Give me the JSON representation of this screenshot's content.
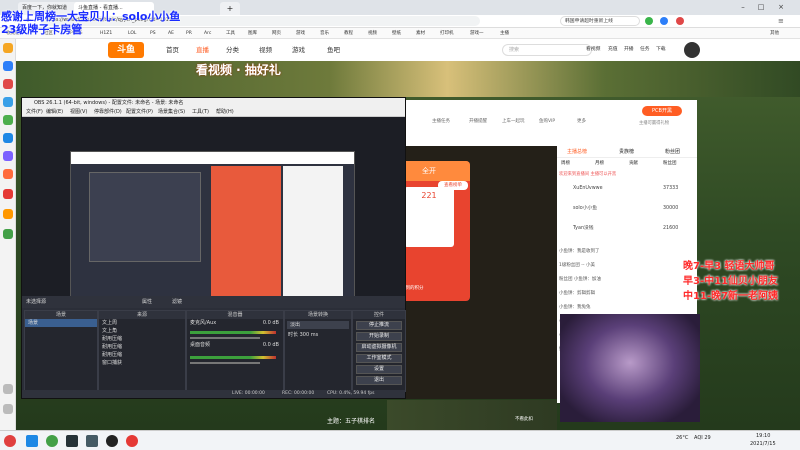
{
  "browser": {
    "tabs": [
      "百度一下，你就知道",
      "斗鱼直播 - 看直播...",
      "",
      ""
    ],
    "url": "https://www.douyu.com/topic/qyyzh_pubg?rid=101367",
    "search_text": "韩国申请超时重新上线",
    "bookmarks": [
      "收藏栏",
      "社区",
      "PUBG",
      "H1Z1",
      "LOL",
      "PS",
      "AE",
      "PR",
      "Arc",
      "工具",
      "图库",
      "网页",
      "游戏",
      "音乐",
      "教程",
      "视频",
      "壁纸",
      "素材",
      "打印机",
      "游戏一",
      "主播",
      "其他"
    ]
  },
  "site": {
    "logo": "斗鱼",
    "nav": [
      "首页",
      "直播",
      "分类",
      "视频",
      "游戏",
      "鱼吧"
    ],
    "search_placeholder": "搜索",
    "right_links": [
      "看视频",
      "充值",
      "开播",
      "任务",
      "下载"
    ],
    "banner_text": "看视频 · 抽好礼"
  },
  "obs": {
    "title": "OBS 26.1.1 (64-bit, windows) - 配置文件: 未命名 - 场景: 未命名",
    "menu": [
      "文件(F)",
      "编辑(E)",
      "视图(V)",
      "停靠部件(D)",
      "配置文件(P)",
      "场景集合(S)",
      "工具(T)",
      "帮助(H)"
    ],
    "no_source": "未选择源",
    "tabs": [
      "属性",
      "滤镜"
    ],
    "panels": {
      "scenes": {
        "title": "场景",
        "items": [
          "场景"
        ]
      },
      "sources": {
        "title": "来源",
        "items": [
          "文上周",
          "文上角",
          "耐用压缩",
          "耐用压缩",
          "耐用压缩",
          "窗口捕获"
        ]
      },
      "mixer": {
        "title": "混音器",
        "items": [
          "麦克风/Aux",
          "桌面音频"
        ],
        "db": [
          "0.0 dB",
          "0.0 dB"
        ]
      },
      "transitions": {
        "title": "场景转换",
        "type": "淡出",
        "duration_label": "时长",
        "duration": "300 ms"
      },
      "controls": {
        "title": "控件",
        "buttons": [
          "停止推流",
          "开始录制",
          "启动虚拟摄像机",
          "工作室模式",
          "设置",
          "退出"
        ]
      }
    },
    "status": [
      "LIVE: 00:00:00",
      "REC: 00:00:00",
      "CPU: 0.4%, 59.94 fps"
    ]
  },
  "room": {
    "follow_count": "2004686",
    "follow_label": "关注",
    "gift_title": "221",
    "gift_sub": "今日得到的积分",
    "gift_btn": "查看榜单",
    "tools": [
      "分享",
      "客户端",
      "举报"
    ],
    "bottom_title": "主题：五子棋排名",
    "bottom_right": "不看此扣",
    "top_tabs": [
      "贵族",
      "主播任务",
      "开播提醒",
      "上车一起玩",
      "鱼购VIP",
      "更多"
    ],
    "pk_label": "PCB开黑",
    "pk_sub": "主播可赢得礼物"
  },
  "chat": {
    "tabs": [
      "主播总榜",
      "贵族榜",
      "粉丝团"
    ],
    "subtabs": [
      "周榜",
      "月榜",
      "贡献",
      "粉丝团"
    ],
    "notice": "欢迎来到直播间 主播可以开黑",
    "ranks": [
      {
        "name": "XuEnUvwwe",
        "score": "37333"
      },
      {
        "name": "solo小小鱼",
        "score": "30000"
      },
      {
        "name": "Tyan没钱",
        "score": "21600"
      }
    ],
    "messages": [
      "小鱼饼：我是收到了",
      "1级粉丝团 -- 小美",
      "粉丝团 小鱼饼：加油",
      "小鱼饼：剪辑剪辑",
      "小鱼饼：我兔兔",
      "小鱼饼：666",
      "小鱼饼：下了晚上",
      "好哟"
    ]
  },
  "overlay": {
    "blue_lines": [
      "感谢上周榜一大宝贝儿：solo小小鱼",
      "23级牌子卡房管"
    ],
    "red_lines": [
      "晚7-早3  轻语大帅哥",
      "早3-中11仙贝小朋友",
      "中11-晚7新一老阿姨"
    ]
  },
  "taskbar": {
    "weather": "26°C",
    "aqi": "AQI 29",
    "time": "19:10",
    "date": "2021/7/15"
  }
}
